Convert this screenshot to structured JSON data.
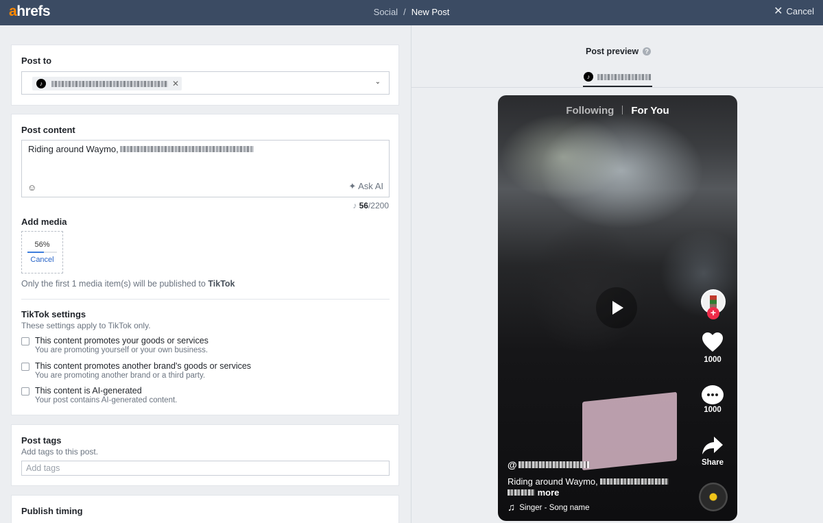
{
  "topbar": {
    "logo_a": "a",
    "logo_rest": "hrefs",
    "breadcrumb_parent": "Social",
    "breadcrumb_sep": "/",
    "breadcrumb_current": "New Post",
    "cancel_label": "Cancel"
  },
  "post_to": {
    "heading": "Post to"
  },
  "post_content": {
    "heading": "Post content",
    "text": "Riding around Waymo,",
    "ask_ai": "Ask AI",
    "count": "56",
    "limit": "2200",
    "counter_sep": "/"
  },
  "media": {
    "heading": "Add media",
    "progress_label": "56%",
    "progress": 0.56,
    "cancel_label": "Cancel",
    "note_prefix": "Only the first 1 media item(s) will be published to",
    "note_platform": "TikTok"
  },
  "tiktok_settings": {
    "heading": "TikTok settings",
    "subtitle": "These settings apply to TikTok only.",
    "options": [
      {
        "label": "This content promotes your goods or services",
        "desc": "You are promoting yourself or your own business."
      },
      {
        "label": "This content promotes another brand's goods or services",
        "desc": "You are promoting another brand or a third party."
      },
      {
        "label": "This content is AI-generated",
        "desc": "Your post contains AI-generated content."
      }
    ]
  },
  "tags": {
    "heading": "Post tags",
    "subtitle": "Add tags to this post.",
    "placeholder": "Add tags"
  },
  "timing": {
    "heading": "Publish timing"
  },
  "preview": {
    "title": "Post preview",
    "help": "?",
    "tab_following": "Following",
    "tab_for_you": "For You",
    "likes": "1000",
    "comments": "1000",
    "share": "Share",
    "handle_prefix": "@",
    "caption": "Riding around Waymo,",
    "more": "more",
    "music": "Singer - Song name"
  },
  "icons": {
    "tiktok": "tiktok-icon",
    "close": "close-icon",
    "chevron": "chevron-down-icon",
    "emoji": "emoji-icon",
    "sparkle": "sparkle-icon",
    "heart": "heart-icon",
    "comment": "comment-icon",
    "share": "share-icon",
    "music": "music-note-icon",
    "play": "play-icon"
  },
  "colors": {
    "topbar": "#3b4b63",
    "brand_orange": "#ff8800",
    "link_blue": "#2864c7",
    "tiktok_red": "#ee2c4a"
  }
}
